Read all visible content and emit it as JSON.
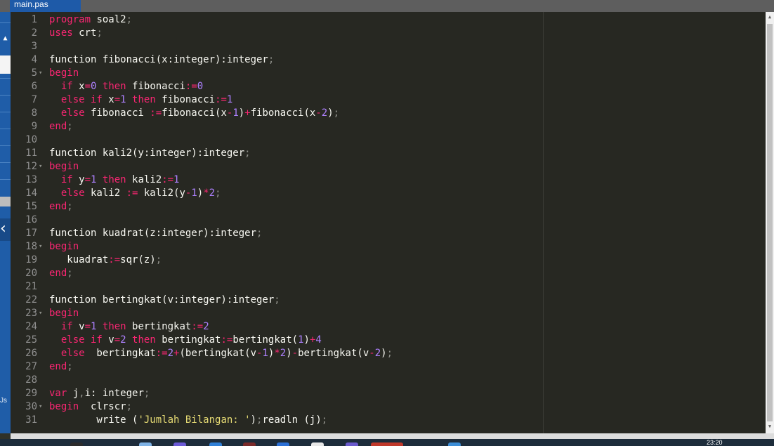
{
  "tab": {
    "title": "main.pas"
  },
  "sidebar": {
    "partial_label": "Js"
  },
  "taskbar": {
    "time": "23:20"
  },
  "editor": {
    "lines": [
      {
        "n": "1",
        "segs": [
          [
            "kw",
            "program"
          ],
          [
            "plain",
            " soal2"
          ],
          [
            "semi",
            ";"
          ]
        ]
      },
      {
        "n": "2",
        "segs": [
          [
            "kw",
            "uses"
          ],
          [
            "plain",
            " crt"
          ],
          [
            "semi",
            ";"
          ]
        ]
      },
      {
        "n": "3",
        "segs": []
      },
      {
        "n": "4",
        "segs": [
          [
            "plain",
            "function fibonacci(x:integer):integer"
          ],
          [
            "semi",
            ";"
          ]
        ]
      },
      {
        "n": "5",
        "fold": true,
        "segs": [
          [
            "kw",
            "begin"
          ]
        ]
      },
      {
        "n": "6",
        "segs": [
          [
            "plain",
            "  "
          ],
          [
            "kw",
            "if"
          ],
          [
            "plain",
            " x"
          ],
          [
            "op",
            "="
          ],
          [
            "num",
            "0"
          ],
          [
            "plain",
            " "
          ],
          [
            "kw",
            "then"
          ],
          [
            "plain",
            " fibonacci"
          ],
          [
            "op",
            ":="
          ],
          [
            "num",
            "0"
          ]
        ]
      },
      {
        "n": "7",
        "segs": [
          [
            "plain",
            "  "
          ],
          [
            "kw",
            "else if"
          ],
          [
            "plain",
            " x"
          ],
          [
            "op",
            "="
          ],
          [
            "num",
            "1"
          ],
          [
            "plain",
            " "
          ],
          [
            "kw",
            "then"
          ],
          [
            "plain",
            " fibonacci"
          ],
          [
            "op",
            ":="
          ],
          [
            "num",
            "1"
          ]
        ]
      },
      {
        "n": "8",
        "segs": [
          [
            "plain",
            "  "
          ],
          [
            "kw",
            "else"
          ],
          [
            "plain",
            " fibonacci "
          ],
          [
            "op",
            ":="
          ],
          [
            "plain",
            "fibonacci(x"
          ],
          [
            "op",
            "-"
          ],
          [
            "num",
            "1"
          ],
          [
            "plain",
            ")"
          ],
          [
            "op",
            "+"
          ],
          [
            "plain",
            "fibonacci(x"
          ],
          [
            "op",
            "-"
          ],
          [
            "num",
            "2"
          ],
          [
            "plain",
            ")"
          ],
          [
            "semi",
            ";"
          ]
        ]
      },
      {
        "n": "9",
        "segs": [
          [
            "kw",
            "end"
          ],
          [
            "semi",
            ";"
          ]
        ]
      },
      {
        "n": "10",
        "segs": []
      },
      {
        "n": "11",
        "segs": [
          [
            "plain",
            "function kali2(y:integer):integer"
          ],
          [
            "semi",
            ";"
          ]
        ]
      },
      {
        "n": "12",
        "fold": true,
        "segs": [
          [
            "kw",
            "begin"
          ]
        ]
      },
      {
        "n": "13",
        "segs": [
          [
            "plain",
            "  "
          ],
          [
            "kw",
            "if"
          ],
          [
            "plain",
            " y"
          ],
          [
            "op",
            "="
          ],
          [
            "num",
            "1"
          ],
          [
            "plain",
            " "
          ],
          [
            "kw",
            "then"
          ],
          [
            "plain",
            " kali2"
          ],
          [
            "op",
            ":="
          ],
          [
            "num",
            "1"
          ]
        ]
      },
      {
        "n": "14",
        "segs": [
          [
            "plain",
            "  "
          ],
          [
            "kw",
            "else"
          ],
          [
            "plain",
            " kali2 "
          ],
          [
            "op",
            ":="
          ],
          [
            "plain",
            " kali2(y"
          ],
          [
            "op",
            "-"
          ],
          [
            "num",
            "1"
          ],
          [
            "plain",
            ")"
          ],
          [
            "op",
            "*"
          ],
          [
            "num",
            "2"
          ],
          [
            "semi",
            ";"
          ]
        ]
      },
      {
        "n": "15",
        "segs": [
          [
            "kw",
            "end"
          ],
          [
            "semi",
            ";"
          ]
        ]
      },
      {
        "n": "16",
        "segs": []
      },
      {
        "n": "17",
        "segs": [
          [
            "plain",
            "function kuadrat(z:integer):integer"
          ],
          [
            "semi",
            ";"
          ]
        ]
      },
      {
        "n": "18",
        "fold": true,
        "segs": [
          [
            "kw",
            "begin"
          ]
        ]
      },
      {
        "n": "19",
        "segs": [
          [
            "plain",
            "   kuadrat"
          ],
          [
            "op",
            ":="
          ],
          [
            "plain",
            "sqr(z)"
          ],
          [
            "semi",
            ";"
          ]
        ]
      },
      {
        "n": "20",
        "segs": [
          [
            "kw",
            "end"
          ],
          [
            "semi",
            ";"
          ]
        ]
      },
      {
        "n": "21",
        "segs": []
      },
      {
        "n": "22",
        "segs": [
          [
            "plain",
            "function bertingkat(v:integer):integer"
          ],
          [
            "semi",
            ";"
          ]
        ]
      },
      {
        "n": "23",
        "fold": true,
        "segs": [
          [
            "kw",
            "begin"
          ]
        ]
      },
      {
        "n": "24",
        "segs": [
          [
            "plain",
            "  "
          ],
          [
            "kw",
            "if"
          ],
          [
            "plain",
            " v"
          ],
          [
            "op",
            "="
          ],
          [
            "num",
            "1"
          ],
          [
            "plain",
            " "
          ],
          [
            "kw",
            "then"
          ],
          [
            "plain",
            " bertingkat"
          ],
          [
            "op",
            ":="
          ],
          [
            "num",
            "2"
          ]
        ]
      },
      {
        "n": "25",
        "segs": [
          [
            "plain",
            "  "
          ],
          [
            "kw",
            "else if"
          ],
          [
            "plain",
            " v"
          ],
          [
            "op",
            "="
          ],
          [
            "num",
            "2"
          ],
          [
            "plain",
            " "
          ],
          [
            "kw",
            "then"
          ],
          [
            "plain",
            " bertingkat"
          ],
          [
            "op",
            ":="
          ],
          [
            "plain",
            "bertingkat("
          ],
          [
            "num",
            "1"
          ],
          [
            "plain",
            ")"
          ],
          [
            "op",
            "+"
          ],
          [
            "num",
            "4"
          ]
        ]
      },
      {
        "n": "26",
        "segs": [
          [
            "plain",
            "  "
          ],
          [
            "kw",
            "else"
          ],
          [
            "plain",
            "  bertingkat"
          ],
          [
            "op",
            ":="
          ],
          [
            "num",
            "2"
          ],
          [
            "op",
            "+"
          ],
          [
            "plain",
            "(bertingkat(v"
          ],
          [
            "op",
            "-"
          ],
          [
            "num",
            "1"
          ],
          [
            "plain",
            ")"
          ],
          [
            "op",
            "*"
          ],
          [
            "num",
            "2"
          ],
          [
            "plain",
            ")"
          ],
          [
            "op",
            "-"
          ],
          [
            "plain",
            "bertingkat(v"
          ],
          [
            "op",
            "-"
          ],
          [
            "num",
            "2"
          ],
          [
            "plain",
            ")"
          ],
          [
            "semi",
            ";"
          ]
        ]
      },
      {
        "n": "27",
        "segs": [
          [
            "kw",
            "end"
          ],
          [
            "semi",
            ";"
          ]
        ]
      },
      {
        "n": "28",
        "segs": []
      },
      {
        "n": "29",
        "segs": [
          [
            "kw",
            "var"
          ],
          [
            "plain",
            " j"
          ],
          [
            "semi",
            ","
          ],
          [
            "plain",
            "i: integer"
          ],
          [
            "semi",
            ";"
          ]
        ]
      },
      {
        "n": "30",
        "fold": true,
        "segs": [
          [
            "kw",
            "begin"
          ],
          [
            "plain",
            "  clrscr"
          ],
          [
            "semi",
            ";"
          ]
        ]
      },
      {
        "n": "31",
        "segs": [
          [
            "plain",
            "        write ("
          ],
          [
            "str",
            "'Jumlah Bilangan: '"
          ],
          [
            "plain",
            ")"
          ],
          [
            "semi",
            ";"
          ],
          [
            "plain",
            "readln (j)"
          ],
          [
            "semi",
            ";"
          ]
        ]
      }
    ]
  },
  "colors": {
    "editor_bg": "#272822",
    "keyword": "#f92672",
    "number": "#ae81ff",
    "string": "#e6db74",
    "tab_bg": "#1e5aa8"
  }
}
